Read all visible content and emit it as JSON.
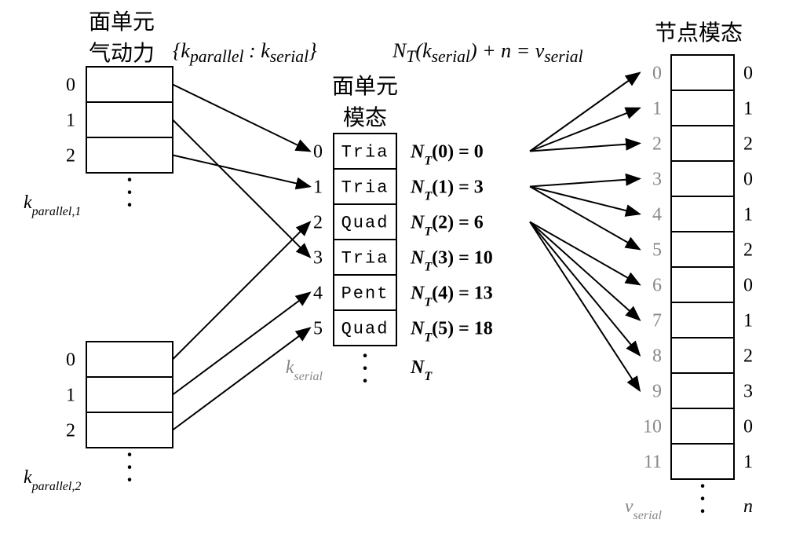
{
  "titles": {
    "left_top": "面单元\n气动力",
    "center": "面单元\n模态",
    "right": "节点模态"
  },
  "formulas": {
    "map_left": "{k_parallel : k_serial}",
    "map_right": "N_T(k_serial) + n = v_serial",
    "k_par1": "k_parallel,1",
    "k_par2": "k_parallel,2",
    "k_serial": "k_serial",
    "NT": "N_T",
    "v_serial": "v_serial",
    "n": "n"
  },
  "left_block": {
    "indices": [
      0,
      1,
      2
    ]
  },
  "center_block": {
    "rows": [
      {
        "idx": 0,
        "type": "Tria",
        "nt_label": "N_T(0) = 0",
        "nt_value": 0
      },
      {
        "idx": 1,
        "type": "Tria",
        "nt_label": "N_T(1) = 3",
        "nt_value": 3
      },
      {
        "idx": 2,
        "type": "Quad",
        "nt_label": "N_T(2) = 6",
        "nt_value": 6
      },
      {
        "idx": 3,
        "type": "Tria",
        "nt_label": "N_T(3) = 10",
        "nt_value": 10
      },
      {
        "idx": 4,
        "type": "Pent",
        "nt_label": "N_T(4) = 13",
        "nt_value": 13
      },
      {
        "idx": 5,
        "type": "Quad",
        "nt_label": "N_T(5) = 18",
        "nt_value": 18
      }
    ]
  },
  "right_block": {
    "rows": [
      {
        "v": 0,
        "n": 0
      },
      {
        "v": 1,
        "n": 1
      },
      {
        "v": 2,
        "n": 2
      },
      {
        "v": 3,
        "n": 0
      },
      {
        "v": 4,
        "n": 1
      },
      {
        "v": 5,
        "n": 2
      },
      {
        "v": 6,
        "n": 0
      },
      {
        "v": 7,
        "n": 1
      },
      {
        "v": 8,
        "n": 2
      },
      {
        "v": 9,
        "n": 3
      },
      {
        "v": 10,
        "n": 0
      },
      {
        "v": 11,
        "n": 1
      }
    ]
  },
  "arrows_left_to_center": [
    {
      "from_block": 1,
      "from_idx": 0,
      "to_row": 0
    },
    {
      "from_block": 1,
      "from_idx": 1,
      "to_row": 3
    },
    {
      "from_block": 1,
      "from_idx": 2,
      "to_row": 1
    },
    {
      "from_block": 2,
      "from_idx": 0,
      "to_row": 2
    },
    {
      "from_block": 2,
      "from_idx": 1,
      "to_row": 4
    },
    {
      "from_block": 2,
      "from_idx": 2,
      "to_row": 5
    }
  ],
  "arrows_center_to_right": [
    {
      "from_row": 0,
      "to_v": 0
    },
    {
      "from_row": 0,
      "to_v": 1
    },
    {
      "from_row": 0,
      "to_v": 2
    },
    {
      "from_row": 1,
      "to_v": 3
    },
    {
      "from_row": 1,
      "to_v": 4
    },
    {
      "from_row": 1,
      "to_v": 5
    },
    {
      "from_row": 2,
      "to_v": 6
    },
    {
      "from_row": 2,
      "to_v": 7
    },
    {
      "from_row": 2,
      "to_v": 8
    },
    {
      "from_row": 2,
      "to_v": 9
    }
  ],
  "chart_data": {
    "type": "table",
    "description": "Mapping diagram from parallel face-element aerodynamic indices to serial face-element modal indices to serial vertex modal indices",
    "left_blocks": [
      {
        "name": "k_parallel,1",
        "indices": [
          0,
          1,
          2
        ]
      },
      {
        "name": "k_parallel,2",
        "indices": [
          0,
          1,
          2
        ]
      }
    ],
    "face_elements_serial": [
      {
        "k_serial": 0,
        "polygon": "Tria",
        "NT": 0
      },
      {
        "k_serial": 1,
        "polygon": "Tria",
        "NT": 3
      },
      {
        "k_serial": 2,
        "polygon": "Quad",
        "NT": 6
      },
      {
        "k_serial": 3,
        "polygon": "Tria",
        "NT": 10
      },
      {
        "k_serial": 4,
        "polygon": "Pent",
        "NT": 13
      },
      {
        "k_serial": 5,
        "polygon": "Quad",
        "NT": 18
      }
    ],
    "vertex_modal": [
      {
        "v_serial": 0,
        "n": 0
      },
      {
        "v_serial": 1,
        "n": 1
      },
      {
        "v_serial": 2,
        "n": 2
      },
      {
        "v_serial": 3,
        "n": 0
      },
      {
        "v_serial": 4,
        "n": 1
      },
      {
        "v_serial": 5,
        "n": 2
      },
      {
        "v_serial": 6,
        "n": 0
      },
      {
        "v_serial": 7,
        "n": 1
      },
      {
        "v_serial": 8,
        "n": 2
      },
      {
        "v_serial": 9,
        "n": 3
      },
      {
        "v_serial": 10,
        "n": 0
      },
      {
        "v_serial": 11,
        "n": 1
      }
    ],
    "mapping_parallel_to_serial": [
      {
        "k_parallel_block": 1,
        "k_parallel": 0,
        "k_serial": 0
      },
      {
        "k_parallel_block": 1,
        "k_parallel": 1,
        "k_serial": 3
      },
      {
        "k_parallel_block": 1,
        "k_parallel": 2,
        "k_serial": 1
      },
      {
        "k_parallel_block": 2,
        "k_parallel": 0,
        "k_serial": 2
      },
      {
        "k_parallel_block": 2,
        "k_parallel": 1,
        "k_serial": 4
      },
      {
        "k_parallel_block": 2,
        "k_parallel": 2,
        "k_serial": 5
      }
    ],
    "mapping_serial_to_vertex_examples": [
      {
        "k_serial": 0,
        "v_serial_targets": [
          0,
          1,
          2
        ]
      },
      {
        "k_serial": 1,
        "v_serial_targets": [
          3,
          4,
          5
        ]
      },
      {
        "k_serial": 2,
        "v_serial_targets": [
          6,
          7,
          8,
          9
        ]
      }
    ],
    "relation": "v_serial = N_T(k_serial) + n"
  }
}
